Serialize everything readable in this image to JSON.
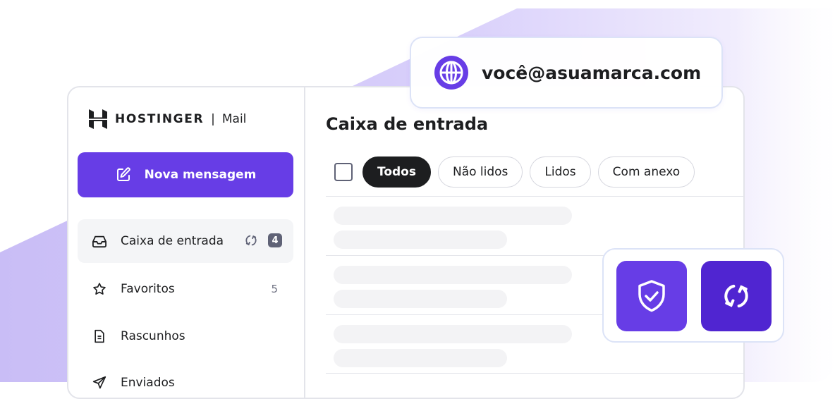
{
  "brand": {
    "name": "HOSTINGER",
    "separator": "|",
    "product": "Mail"
  },
  "compose": {
    "label": "Nova mensagem",
    "icon": "pencil-square-icon"
  },
  "sidebar": {
    "items": [
      {
        "label": "Caixa de entrada",
        "icon": "inbox-icon",
        "badge": "4",
        "active": true
      },
      {
        "label": "Favoritos",
        "icon": "star-icon",
        "count": "5"
      },
      {
        "label": "Rascunhos",
        "icon": "file-icon"
      },
      {
        "label": "Enviados",
        "icon": "send-icon"
      }
    ]
  },
  "main": {
    "title": "Caixa de entrada",
    "filters": [
      "Todos",
      "Não lidos",
      "Lidos",
      "Com anexo"
    ],
    "active_filter": "Todos"
  },
  "email_card": {
    "address": "você@asuamarca.com",
    "icon": "globe-icon"
  },
  "actions": [
    {
      "name": "security",
      "icon": "shield-check-icon"
    },
    {
      "name": "sync",
      "icon": "sync-icon"
    }
  ],
  "colors": {
    "accent": "#673de6",
    "accent_dark": "#5025d1",
    "text": "#1d1e20",
    "background_shape": "#c9bdf6"
  }
}
